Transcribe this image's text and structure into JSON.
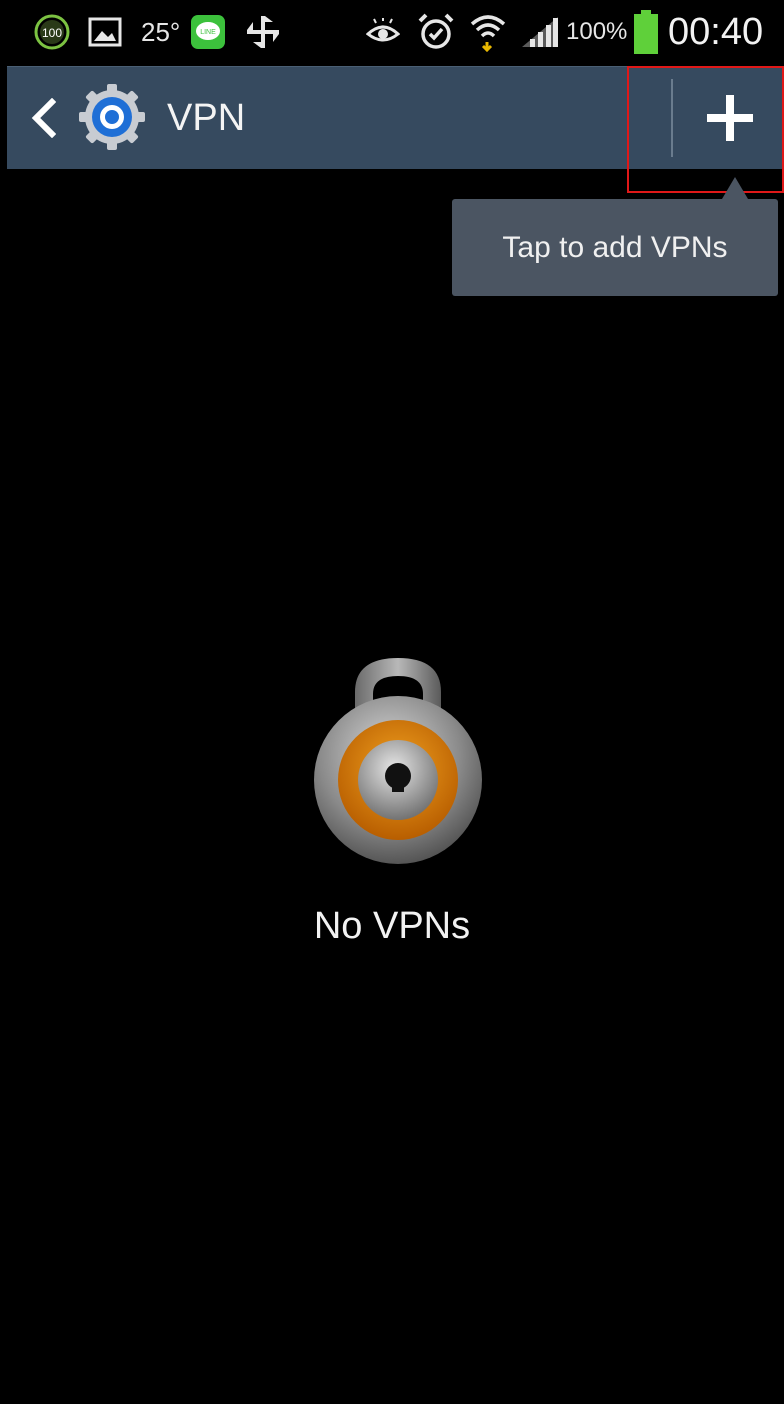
{
  "status_bar": {
    "icons": [
      "battery-saver-100-icon",
      "gallery-icon",
      "temperature-text",
      "line-app-icon",
      "pinwheel-app-icon",
      "eye-icon",
      "alarm-icon",
      "wifi-icon",
      "signal-icon",
      "battery-icon"
    ],
    "battery_saver_badge": "100",
    "temperature": "25°",
    "line_badge": "LINE",
    "battery_percent": "100%",
    "time": "00:40"
  },
  "action_bar": {
    "title": "VPN",
    "add_label": "+"
  },
  "tooltip": {
    "text": "Tap to add VPNs"
  },
  "empty_state": {
    "message": "No VPNs"
  },
  "colors": {
    "action_bar": "#364a5f",
    "tooltip": "#4b5562",
    "highlight": "#e01818",
    "battery": "#5fd03a",
    "lock_ring": "#d07a0c"
  }
}
